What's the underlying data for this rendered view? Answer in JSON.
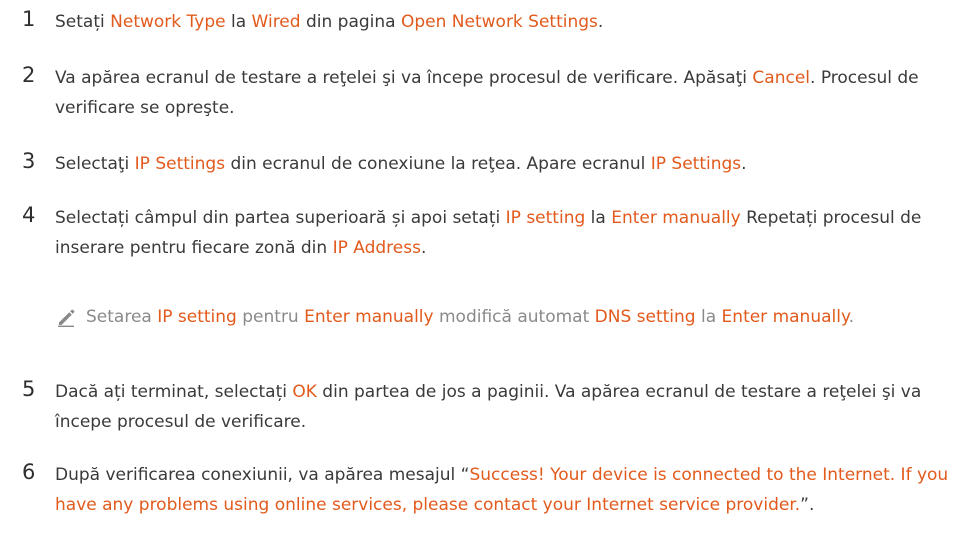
{
  "steps": [
    {
      "num": "1",
      "parts": [
        {
          "t": "Setați "
        },
        {
          "t": "Network Type",
          "hl": true
        },
        {
          "t": " la "
        },
        {
          "t": "Wired",
          "hl": true
        },
        {
          "t": " din pagina "
        },
        {
          "t": "Open Network Settings",
          "hl": true
        },
        {
          "t": "."
        }
      ]
    },
    {
      "num": "2",
      "parts": [
        {
          "t": "Va apărea ecranul de testare a reţelei şi va începe procesul de verificare. Apăsaţi "
        },
        {
          "t": "Cancel",
          "hl": true
        },
        {
          "t": ". Procesul de verificare se opreşte."
        }
      ]
    },
    {
      "num": "3",
      "parts": [
        {
          "t": "Selectaţi "
        },
        {
          "t": "IP Settings",
          "hl": true
        },
        {
          "t": " din ecranul de conexiune la reţea. Apare ecranul "
        },
        {
          "t": "IP Settings",
          "hl": true
        },
        {
          "t": "."
        }
      ]
    },
    {
      "num": "4",
      "parts": [
        {
          "t": "Selectați câmpul din partea superioară și apoi setați "
        },
        {
          "t": "IP setting",
          "hl": true
        },
        {
          "t": " la "
        },
        {
          "t": "Enter manually",
          "hl": true
        },
        {
          "t": " Repetați procesul de inserare pentru fiecare zonă din "
        },
        {
          "t": "IP Address",
          "hl": true
        },
        {
          "t": "."
        }
      ]
    },
    {
      "num": "5",
      "parts": [
        {
          "t": "Dacă ați terminat, selectați "
        },
        {
          "t": "OK",
          "hl": true
        },
        {
          "t": " din partea de jos a paginii. Va apărea ecranul de testare a reţelei şi va începe procesul de verificare."
        }
      ]
    },
    {
      "num": "6",
      "parts": [
        {
          "t": "După verificarea conexiunii, va apărea mesajul “"
        },
        {
          "t": "Success! Your device is connected to the Internet. If you have any problems using online services, please contact your Internet service provider.",
          "hl": true
        },
        {
          "t": "”."
        }
      ]
    }
  ],
  "note": {
    "icon": "pencil-icon",
    "parts": [
      {
        "t": "Setarea "
      },
      {
        "t": "IP setting",
        "hl": true
      },
      {
        "t": " pentru "
      },
      {
        "t": "Enter manually",
        "hl": true
      },
      {
        "t": " modifică automat "
      },
      {
        "t": "DNS setting",
        "hl": true
      },
      {
        "t": " la "
      },
      {
        "t": "Enter manually",
        "hl": true
      },
      {
        "t": "."
      }
    ]
  },
  "colors": {
    "highlight": "#e25a1c",
    "body_text": "#3a3a3a",
    "note_text": "#8a8a8a"
  }
}
